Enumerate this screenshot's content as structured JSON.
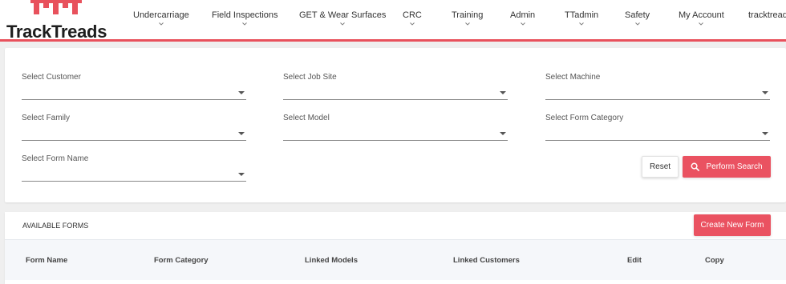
{
  "header": {
    "logo_text": "TrackTreads",
    "nav": [
      {
        "label": "Undercarriage"
      },
      {
        "label": "Field Inspections"
      },
      {
        "label": "GET & Wear Surfaces"
      },
      {
        "label": "CRC"
      },
      {
        "label": "Training"
      },
      {
        "label": "Admin"
      },
      {
        "label": "TTadmin"
      },
      {
        "label": "Safety"
      },
      {
        "label": "My Account"
      },
      {
        "label": "tracktreads"
      }
    ]
  },
  "filters": {
    "customer": "Select Customer",
    "job_site": "Select Job Site",
    "machine": "Select Machine",
    "family": "Select Family",
    "model": "Select Model",
    "form_category": "Select Form Category",
    "form_name": "Select Form Name"
  },
  "actions": {
    "reset_label": "Reset",
    "search_label": "Perform Search"
  },
  "forms": {
    "title": "AVAILABLE FORMS",
    "create_label": "Create New Form",
    "columns": [
      "Form Name",
      "Form Category",
      "Linked Models",
      "Linked Customers",
      "Edit",
      "Copy"
    ]
  },
  "colors": {
    "accent": "#ea5261",
    "header_border": "#e8515c"
  }
}
